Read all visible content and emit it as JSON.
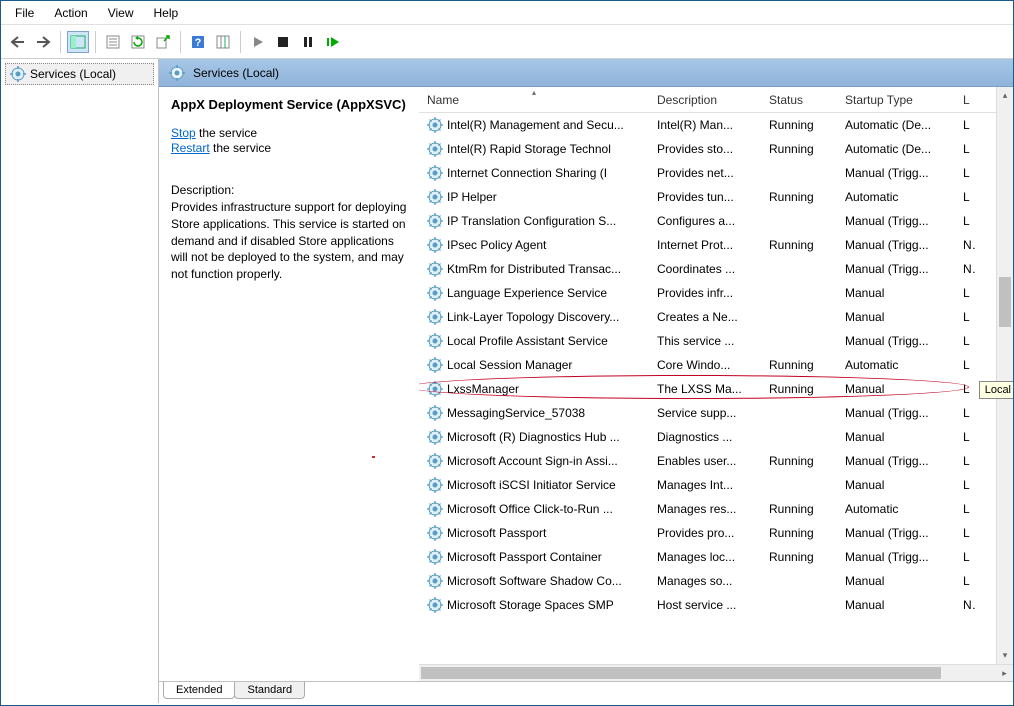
{
  "menu": {
    "items": [
      "File",
      "Action",
      "View",
      "Help"
    ]
  },
  "tree": {
    "root": "Services (Local)"
  },
  "header": {
    "title": "Services (Local)"
  },
  "detail": {
    "title": "AppX Deployment Service (AppXSVC)",
    "stop_label": "Stop",
    "stop_suffix": " the service",
    "restart_label": "Restart",
    "restart_suffix": " the service",
    "desc_label": "Description:",
    "desc_text": "Provides infrastructure support for deploying Store applications. This service is started on demand and if disabled Store applications will not be deployed to the system, and may not function properly."
  },
  "columns": {
    "name": "Name",
    "desc": "Description",
    "status": "Status",
    "startup": "Startup Type",
    "log": "L"
  },
  "services": [
    {
      "name": "Intel(R) Management and Secu...",
      "desc": "Intel(R) Man...",
      "status": "Running",
      "startup": "Automatic (De...",
      "log": "L"
    },
    {
      "name": "Intel(R) Rapid Storage Technol",
      "desc": "Provides sto...",
      "status": "Running",
      "startup": "Automatic (De...",
      "log": "L"
    },
    {
      "name": "Internet Connection Sharing (I",
      "desc": "Provides net...",
      "status": "",
      "startup": "Manual (Trigg...",
      "log": "L"
    },
    {
      "name": "IP Helper",
      "desc": "Provides tun...",
      "status": "Running",
      "startup": "Automatic",
      "log": "L"
    },
    {
      "name": "IP Translation Configuration S...",
      "desc": "Configures a...",
      "status": "",
      "startup": "Manual (Trigg...",
      "log": "L"
    },
    {
      "name": "IPsec Policy Agent",
      "desc": "Internet Prot...",
      "status": "Running",
      "startup": "Manual (Trigg...",
      "log": "N"
    },
    {
      "name": "KtmRm for Distributed Transac...",
      "desc": "Coordinates ...",
      "status": "",
      "startup": "Manual (Trigg...",
      "log": "N"
    },
    {
      "name": "Language Experience Service",
      "desc": "Provides infr...",
      "status": "",
      "startup": "Manual",
      "log": "L"
    },
    {
      "name": "Link-Layer Topology Discovery...",
      "desc": "Creates a Ne...",
      "status": "",
      "startup": "Manual",
      "log": "L"
    },
    {
      "name": "Local Profile Assistant Service",
      "desc": "This service ...",
      "status": "",
      "startup": "Manual (Trigg...",
      "log": "L"
    },
    {
      "name": "Local Session Manager",
      "desc": "Core Windo...",
      "status": "Running",
      "startup": "Automatic",
      "log": "L"
    },
    {
      "name": "LxssManager",
      "desc": "The LXSS Ma...",
      "status": "Running",
      "startup": "Manual",
      "log": "L"
    },
    {
      "name": "MessagingService_57038",
      "desc": "Service supp...",
      "status": "",
      "startup": "Manual (Trigg...",
      "log": "L"
    },
    {
      "name": "Microsoft (R) Diagnostics Hub ...",
      "desc": "Diagnostics ...",
      "status": "",
      "startup": "Manual",
      "log": "L"
    },
    {
      "name": "Microsoft Account Sign-in Assi...",
      "desc": "Enables user...",
      "status": "Running",
      "startup": "Manual (Trigg...",
      "log": "L"
    },
    {
      "name": "Microsoft iSCSI Initiator Service",
      "desc": "Manages Int...",
      "status": "",
      "startup": "Manual",
      "log": "L"
    },
    {
      "name": "Microsoft Office Click-to-Run ...",
      "desc": "Manages res...",
      "status": "Running",
      "startup": "Automatic",
      "log": "L"
    },
    {
      "name": "Microsoft Passport",
      "desc": "Provides pro...",
      "status": "Running",
      "startup": "Manual (Trigg...",
      "log": "L"
    },
    {
      "name": "Microsoft Passport Container",
      "desc": "Manages loc...",
      "status": "Running",
      "startup": "Manual (Trigg...",
      "log": "L"
    },
    {
      "name": "Microsoft Software Shadow Co...",
      "desc": "Manages so...",
      "status": "",
      "startup": "Manual",
      "log": "L"
    },
    {
      "name": "Microsoft Storage Spaces SMP",
      "desc": "Host service ...",
      "status": "",
      "startup": "Manual",
      "log": "N"
    }
  ],
  "tabs": {
    "extended": "Extended",
    "standard": "Standard"
  },
  "tooltip": "Local"
}
